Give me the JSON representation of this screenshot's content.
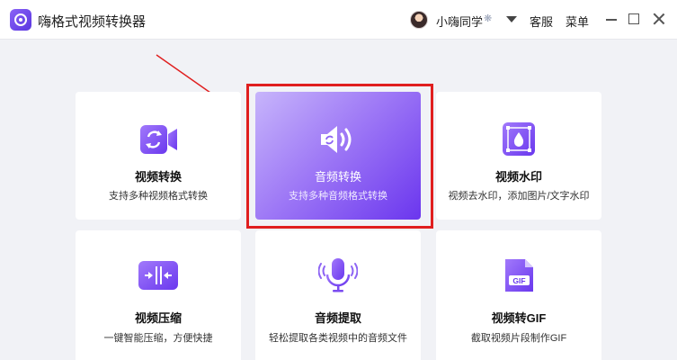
{
  "app": {
    "title": "嗨格式视频转换器"
  },
  "header": {
    "username": "小嗨同学",
    "user_badge": "❋",
    "support_label": "客服",
    "menu_label": "菜单"
  },
  "cards": [
    {
      "title": "视频转换",
      "desc": "支持多种视频格式转换",
      "icon": "video-convert-icon"
    },
    {
      "title": "音频转换",
      "desc": "支持多种音频格式转换",
      "icon": "audio-convert-icon",
      "selected": true
    },
    {
      "title": "视频水印",
      "desc": "视频去水印，添加图片/文字水印",
      "icon": "video-watermark-icon"
    },
    {
      "title": "视频压缩",
      "desc": "一键智能压缩，方便快捷",
      "icon": "video-compress-icon"
    },
    {
      "title": "音频提取",
      "desc": "轻松提取各类视频中的音频文件",
      "icon": "audio-extract-icon"
    },
    {
      "title": "视频转GIF",
      "desc": "截取视频片段制作GIF",
      "icon": "video-to-gif-icon"
    }
  ],
  "colors": {
    "accent": "#7b4cf0",
    "annotation": "#e01f1f"
  }
}
